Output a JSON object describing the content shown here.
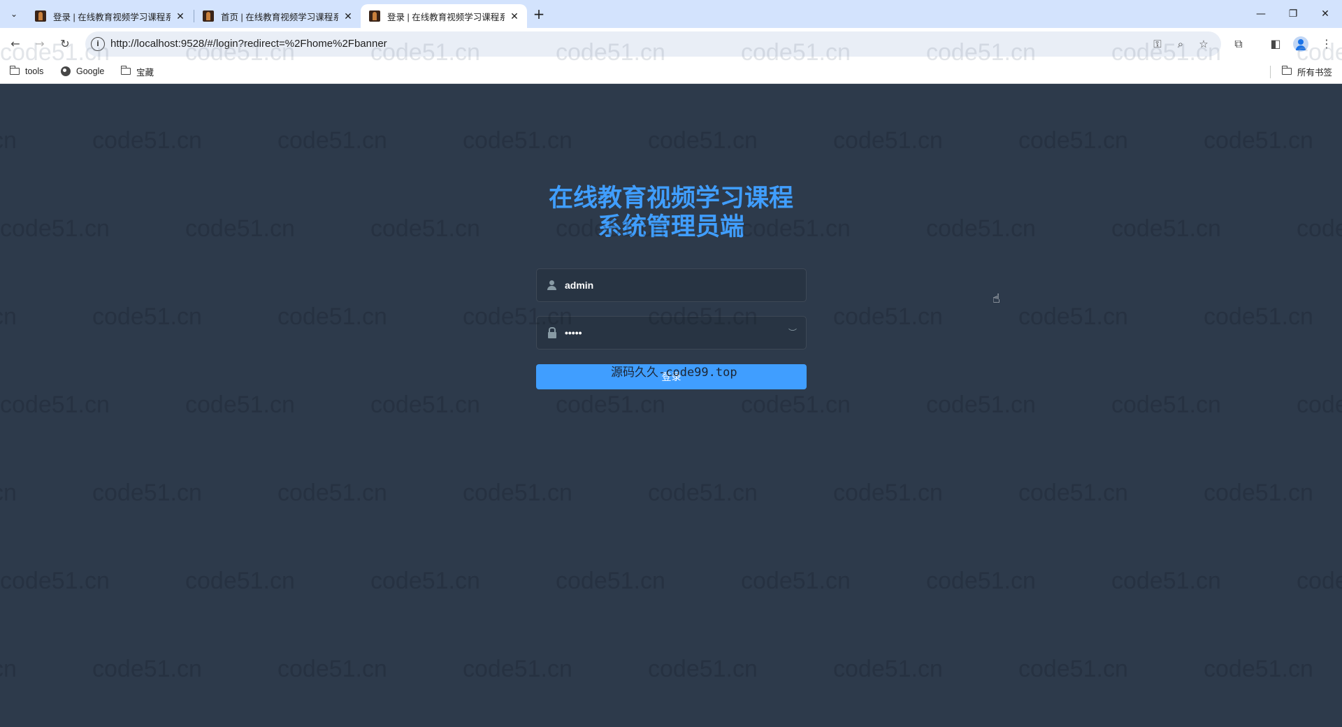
{
  "browser": {
    "tabs": [
      {
        "title": "登录 | 在线教育视频学习课程系统",
        "active": false
      },
      {
        "title": "首页 | 在线教育视频学习课程系统",
        "active": false
      },
      {
        "title": "登录 | 在线教育视频学习课程系统",
        "active": true
      }
    ],
    "url": "http://localhost:9528/#/login?redirect=%2Fhome%2Fbanner",
    "bookmarks": [
      {
        "label": "tools",
        "icon": "folder-icon"
      },
      {
        "label": "Google",
        "icon": "globe-icon"
      },
      {
        "label": "宝藏",
        "icon": "folder-icon"
      }
    ],
    "all_bookmarks_label": "所有书签"
  },
  "login": {
    "title_line1": "在线教育视频学习课程",
    "title_line2": "系统管理员端",
    "username_value": "admin",
    "password_value": "•••••",
    "login_button_label": "登录"
  },
  "overlay_watermark": "源码久久-code99.top",
  "page_watermark": "code51.cn",
  "colors": {
    "background": "#2d3a4b",
    "accent": "#409eff",
    "tabstrip": "#d3e3fd"
  }
}
